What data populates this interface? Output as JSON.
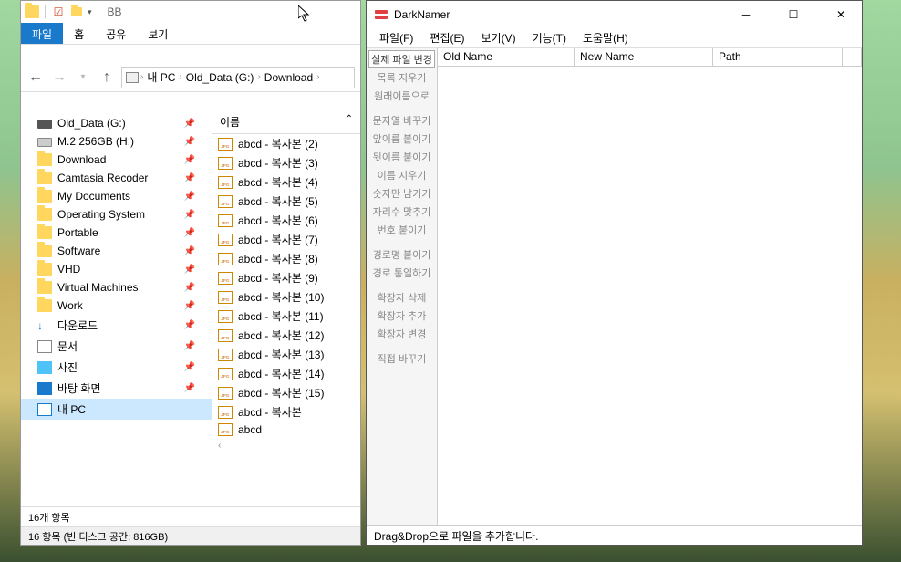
{
  "explorer": {
    "title_text": "BB",
    "tabs": {
      "file": "파일",
      "home": "홈",
      "share": "공유",
      "view": "보기"
    },
    "breadcrumb": [
      "내 PC",
      "Old_Data (G:)",
      "Download"
    ],
    "tree": [
      {
        "label": "Old_Data (G:)",
        "icon": "drive-dark",
        "pinned": true
      },
      {
        "label": "M.2 256GB (H:)",
        "icon": "drive-light",
        "pinned": true
      },
      {
        "label": "Download",
        "icon": "folder",
        "pinned": true
      },
      {
        "label": "Camtasia Recoder",
        "icon": "folder",
        "pinned": true
      },
      {
        "label": "My Documents",
        "icon": "folder",
        "pinned": true
      },
      {
        "label": "Operating System",
        "icon": "folder",
        "pinned": true
      },
      {
        "label": "Portable",
        "icon": "folder",
        "pinned": true
      },
      {
        "label": "Software",
        "icon": "folder",
        "pinned": true
      },
      {
        "label": "VHD",
        "icon": "folder",
        "pinned": true
      },
      {
        "label": "Virtual Machines",
        "icon": "folder",
        "pinned": true
      },
      {
        "label": "Work",
        "icon": "folder",
        "pinned": true
      },
      {
        "label": "다운로드",
        "icon": "download",
        "pinned": true
      },
      {
        "label": "문서",
        "icon": "doc",
        "pinned": true
      },
      {
        "label": "사진",
        "icon": "pic",
        "pinned": true
      },
      {
        "label": "바탕 화면",
        "icon": "desktop",
        "pinned": true
      },
      {
        "label": "내 PC",
        "icon": "pc",
        "pinned": false,
        "selected": true
      }
    ],
    "list_header": "이름",
    "files": [
      "abcd - 복사본 (2)",
      "abcd - 복사본 (3)",
      "abcd - 복사본 (4)",
      "abcd - 복사본 (5)",
      "abcd - 복사본 (6)",
      "abcd - 복사본 (7)",
      "abcd - 복사본 (8)",
      "abcd - 복사본 (9)",
      "abcd - 복사본 (10)",
      "abcd - 복사본 (11)",
      "abcd - 복사본 (12)",
      "abcd - 복사본 (13)",
      "abcd - 복사본 (14)",
      "abcd - 복사본 (15)",
      "abcd - 복사본",
      "abcd"
    ],
    "status1": "16개 항목",
    "status2": "16 항목 (빈 디스크 공간: 816GB)"
  },
  "darknamer": {
    "title": "DarkNamer",
    "menu": {
      "file": "파일(F)",
      "edit": "편집(E)",
      "view": "보기(V)",
      "func": "기능(T)",
      "help": "도움말(H)"
    },
    "buttons": [
      {
        "label": "실제 파일 변경",
        "primary": true
      },
      {
        "label": "목록 지우기"
      },
      {
        "label": "원래이름으로"
      },
      {
        "gap": true
      },
      {
        "label": "문자열 바꾸기"
      },
      {
        "label": "앞이름 붙이기"
      },
      {
        "label": "뒷이름 붙이기"
      },
      {
        "label": "이름 지우기"
      },
      {
        "label": "숫자만 남기기"
      },
      {
        "label": "자리수 맞추기"
      },
      {
        "label": "번호 붙이기"
      },
      {
        "gap": true
      },
      {
        "label": "경로명 붙이기"
      },
      {
        "label": "경로 통일하기"
      },
      {
        "gap": true
      },
      {
        "label": "확장자 삭제"
      },
      {
        "label": "확장자 추가"
      },
      {
        "label": "확장자 변경"
      },
      {
        "gap": true
      },
      {
        "label": "직접 바꾸기"
      }
    ],
    "columns": [
      "Old Name",
      "New Name",
      "Path",
      ""
    ],
    "status": "Drag&Drop으로 파일을 추가합니다."
  }
}
